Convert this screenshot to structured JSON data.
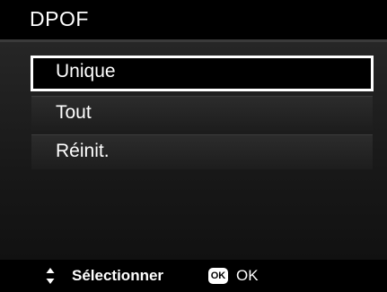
{
  "header": {
    "title": "DPOF"
  },
  "menu": {
    "items": [
      {
        "label": "Unique",
        "selected": true
      },
      {
        "label": "Tout",
        "selected": false
      },
      {
        "label": "Réinit.",
        "selected": false
      }
    ]
  },
  "footer": {
    "nav_icon": "up-down-arrows-icon",
    "select_label": "Sélectionner",
    "ok_icon_text": "OK",
    "ok_label": "OK"
  },
  "colors": {
    "background": "#000000",
    "text": "#ffffff",
    "selection_border": "#ffffff"
  }
}
